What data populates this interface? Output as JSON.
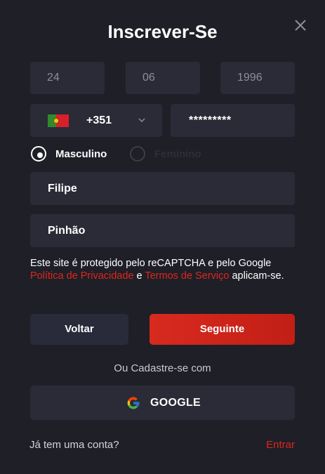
{
  "header": {
    "title": "Inscrever-Se",
    "close_icon": "close-icon"
  },
  "birthdate": {
    "day": "24",
    "month": "06",
    "year": "1996"
  },
  "phone": {
    "flag_icon": "portugal-flag-icon",
    "dial_code": "+351",
    "dropdown_icon": "chevron-down-icon",
    "password_masked": "*********"
  },
  "gender": {
    "options": [
      "Masculino",
      "Feminino"
    ],
    "selected": "Masculino"
  },
  "name": {
    "first": "Filipe",
    "last": "Pinhão"
  },
  "legal": {
    "text_start": "Este site é protegido pelo reCAPTCHA e pelo Google ",
    "privacy_link": "Política de Privacidade",
    "and": " e ",
    "terms_link": "Termos de Serviço",
    "text_end": " aplicam-se."
  },
  "actions": {
    "back_label": "Voltar",
    "next_label": "Seguinte"
  },
  "social": {
    "or_label": "Ou Cadastre-se com",
    "google_label": "GOOGLE",
    "google_icon": "google-g-icon"
  },
  "footer": {
    "question": "Já tem uma conta?",
    "login_link": "Entrar"
  },
  "colors": {
    "background": "#1e1f27",
    "field": "#2a2b36",
    "accent": "#e0261b"
  }
}
